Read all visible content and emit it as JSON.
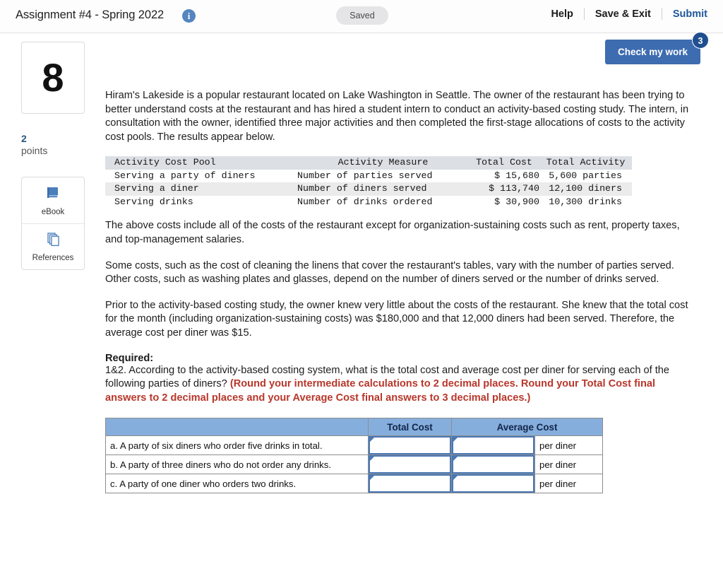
{
  "header": {
    "assignment_title": "Assignment #4 - Spring 2022",
    "info_icon": "info-icon",
    "status_pill": "Saved",
    "help_label": "Help",
    "save_exit_label": "Save & Exit",
    "submit_label": "Submit"
  },
  "check_work": {
    "label": "Check my work",
    "badge_count": "3",
    "button_color": "#3d6cb0",
    "badge_color": "#1f4f8f"
  },
  "rail": {
    "question_number": "8",
    "points_value": "2",
    "points_label": "points",
    "tools": [
      {
        "icon": "book-icon",
        "label": "eBook"
      },
      {
        "icon": "pages-icon",
        "label": "References"
      }
    ]
  },
  "body": {
    "p1": "Hiram's Lakeside is a popular restaurant located on Lake Washington in Seattle. The owner of the restaurant has been trying to better understand costs at the restaurant and has hired a student intern to conduct an activity-based costing study. The intern, in consultation with the owner, identified three major activities and then completed the first-stage allocations of costs to the activity cost pools. The results appear below.",
    "p2": "The above costs include all of the costs of the restaurant except for organization-sustaining costs such as rent, property taxes, and top-management salaries.",
    "p3": "Some costs, such as the cost of cleaning the linens that cover the restaurant's tables, vary with the number of parties served. Other costs, such as washing plates and glasses, depend on the number of diners served or the number of drinks served.",
    "p4": "Prior to the activity-based costing study, the owner knew very little about the costs of the restaurant. She knew that the total cost for the month (including organization-sustaining costs) was $180,000 and that 12,000 diners had been served. Therefore, the average cost per diner was $15.",
    "required_heading": "Required:",
    "question_text": "1&2. According to the activity-based costing system, what is the total cost and average cost per diner for serving each of the following parties of diners? ",
    "question_note": "(Round your intermediate calculations to 2 decimal places. Round your Total Cost final answers to 2 decimal places and your Average Cost final answers to 3 decimal places.)",
    "note_color": "#b8372b"
  },
  "cost_pool_table": {
    "headers": [
      "Activity Cost Pool",
      "Activity Measure",
      "Total Cost",
      "Total Activity"
    ],
    "rows": [
      {
        "pool": "Serving a party of diners",
        "measure": "Number of parties served",
        "total_cost": "$ 15,680",
        "total_activity": "5,600 parties"
      },
      {
        "pool": "Serving a diner",
        "measure": "Number of diners served",
        "total_cost": "$ 113,740",
        "total_activity": "12,100 diners"
      },
      {
        "pool": "Serving drinks",
        "measure": "Number of drinks ordered",
        "total_cost": "$ 30,900",
        "total_activity": "10,300 drinks"
      }
    ]
  },
  "answer_table": {
    "headers": {
      "blank": "",
      "total_cost": "Total Cost",
      "average_cost": "Average Cost"
    },
    "header_color": "#86aedc",
    "rows": [
      {
        "description": "a. A party of six diners who order five drinks in total.",
        "total_cost": "",
        "average_cost": "",
        "unit": "per diner"
      },
      {
        "description": "b. A party of three diners who do not order any drinks.",
        "total_cost": "",
        "average_cost": "",
        "unit": "per diner"
      },
      {
        "description": "c. A party of one diner who orders two drinks.",
        "total_cost": "",
        "average_cost": "",
        "unit": "per diner"
      }
    ]
  }
}
